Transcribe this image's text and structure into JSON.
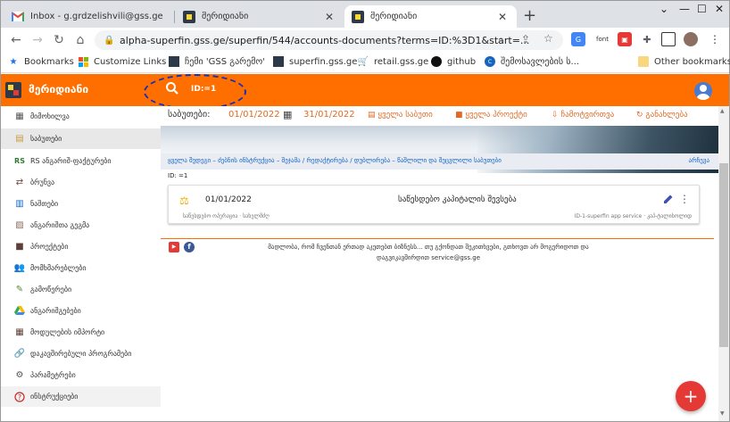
{
  "browser": {
    "tabs": [
      {
        "title": "Inbox - g.grdzelishvili@gss.ge - G",
        "icon": "gmail-icon",
        "active": false
      },
      {
        "title": "მერიდიანი",
        "icon": "app-favicon",
        "active": false
      },
      {
        "title": "მერიდიანი",
        "icon": "app-favicon",
        "active": true
      }
    ],
    "new_tab": "+",
    "url": "alpha-superfin.gss.ge/superfin/544/accounts-documents?terms=ID:%3D1&start=...",
    "extensions": [
      "translate-icon",
      "font",
      "extension-icon",
      "puzzle-icon"
    ],
    "bookmarks": [
      {
        "label": "Bookmarks",
        "icon": "star-icon"
      },
      {
        "label": "Customize Links",
        "icon": "windows-icon"
      },
      {
        "label": "ჩემი 'GSS გარემო'",
        "icon": "app-favicon"
      },
      {
        "label": "superfin.gss.ge",
        "icon": "app-favicon"
      },
      {
        "label": "retail.gss.ge",
        "icon": "cart-icon"
      },
      {
        "label": "github",
        "icon": "github-icon"
      },
      {
        "label": "შემოსავლების ს...",
        "icon": "rs-icon"
      }
    ],
    "other_bookmarks": "Other bookmarks"
  },
  "app": {
    "title": "მერიდიანი",
    "search_query": "ID:=1",
    "accent": "#ff6f00"
  },
  "sidebar": {
    "items": [
      {
        "label": "მიმოხილვა",
        "icon": "grid-icon",
        "active": false
      },
      {
        "label": "საბუთები",
        "icon": "documents-icon",
        "active": true
      },
      {
        "label": "RS ანგარიშ-ფაქტურები",
        "icon": "rs-icon",
        "active": false
      },
      {
        "label": "ბრუნვა",
        "icon": "turnover-icon",
        "active": false
      },
      {
        "label": "ნაშთები",
        "icon": "balance-icon",
        "active": false
      },
      {
        "label": "ანგარიშთა გეგმა",
        "icon": "chart-of-accounts-icon",
        "active": false
      },
      {
        "label": "პროექტები",
        "icon": "folder-icon",
        "active": false
      },
      {
        "label": "მომხმარებლები",
        "icon": "users-icon",
        "active": false
      },
      {
        "label": "გამოწერები",
        "icon": "subscriptions-icon",
        "active": false
      },
      {
        "label": "ანგარიშგებები",
        "icon": "drive-icon",
        "active": false
      },
      {
        "label": "მოდულების იმპორტი",
        "icon": "import-icon",
        "active": false
      },
      {
        "label": "დაკავშირებული პროგრამები",
        "icon": "link-icon",
        "active": false
      },
      {
        "label": "პარამეტრები",
        "icon": "gear-icon",
        "active": false
      },
      {
        "label": "ინსტრუქციები",
        "icon": "help-icon",
        "active": false
      }
    ]
  },
  "filters": {
    "period_label": "საბუთები:",
    "date_from": "01/01/2022",
    "date_to": "31/01/2022",
    "all_documents": "ყველა საბუთი",
    "all_projects": "ყველა პროექტი",
    "correspondence": "ჩამოტვირთვა",
    "refresh": "განახლება"
  },
  "breadcrumb": {
    "text": "ყველა შედეგი – ძებნის ინსტრუქცია – შეჯამა / რედაქტირება / დუბლირება – წაშლილი და შეცვლილი საბუთები",
    "right": "არჩევა"
  },
  "filter_line": "ID: =1",
  "document": {
    "date": "01/01/2022",
    "title": "საწესდებო კაპიტალის შევსება",
    "subtitle_left": "საწესდებო ოპერაცია · სახელმძღ",
    "subtitle_right": "ID-1-superfin app service · კაპ-ტალისოლიდ"
  },
  "footer": {
    "line1": "მადლობა, რომ ჩვენთან ერთად აკეთებთ ბიზნესს... თუ გქონდათ შეკითხვები, გთხოვთ არ მოგერიდოთ და",
    "line2": "დაგვიკავშირდით service@gss.ge",
    "youtube": "▶",
    "facebook": "f"
  },
  "fab": "+"
}
